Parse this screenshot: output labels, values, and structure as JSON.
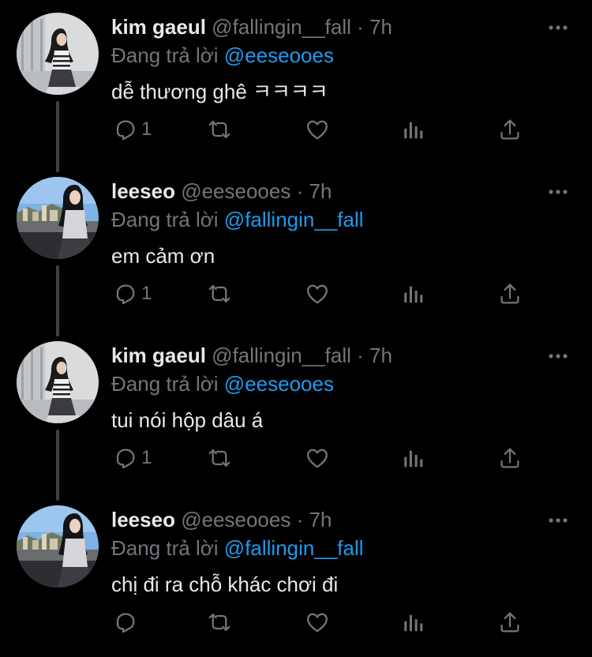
{
  "colors": {
    "background": "#000000",
    "primary_text": "#e7e9ea",
    "secondary_text": "#71767b",
    "mention": "#1d9bf0",
    "thread_line": "#3d4247"
  },
  "icons": [
    "reply-icon",
    "retweet-icon",
    "like-icon",
    "views-icon",
    "share-icon",
    "more-icon"
  ],
  "tweets": [
    {
      "name": "kim gaeul",
      "handle": "@fallingin__fall",
      "dot": "·",
      "time": "7h",
      "reply_prefix": "Đang trả lời",
      "reply_to": "@eeseooes",
      "text": "dễ thương ghê ㅋㅋㅋㅋ",
      "reply_count": "1"
    },
    {
      "name": "leeseo",
      "handle": "@eeseooes",
      "dot": "·",
      "time": "7h",
      "reply_prefix": "Đang trả lời",
      "reply_to": "@fallingin__fall",
      "text": "em cảm ơn",
      "reply_count": "1"
    },
    {
      "name": "kim gaeul",
      "handle": "@fallingin__fall",
      "dot": "·",
      "time": "7h",
      "reply_prefix": "Đang trả lời",
      "reply_to": "@eeseooes",
      "text": "tui nói hộp dâu á",
      "reply_count": "1"
    },
    {
      "name": "leeseo",
      "handle": "@eeseooes",
      "dot": "·",
      "time": "7h",
      "reply_prefix": "Đang trả lời",
      "reply_to": "@fallingin__fall",
      "text": "chị đi ra chỗ khác chơi đi",
      "reply_count": ""
    }
  ]
}
